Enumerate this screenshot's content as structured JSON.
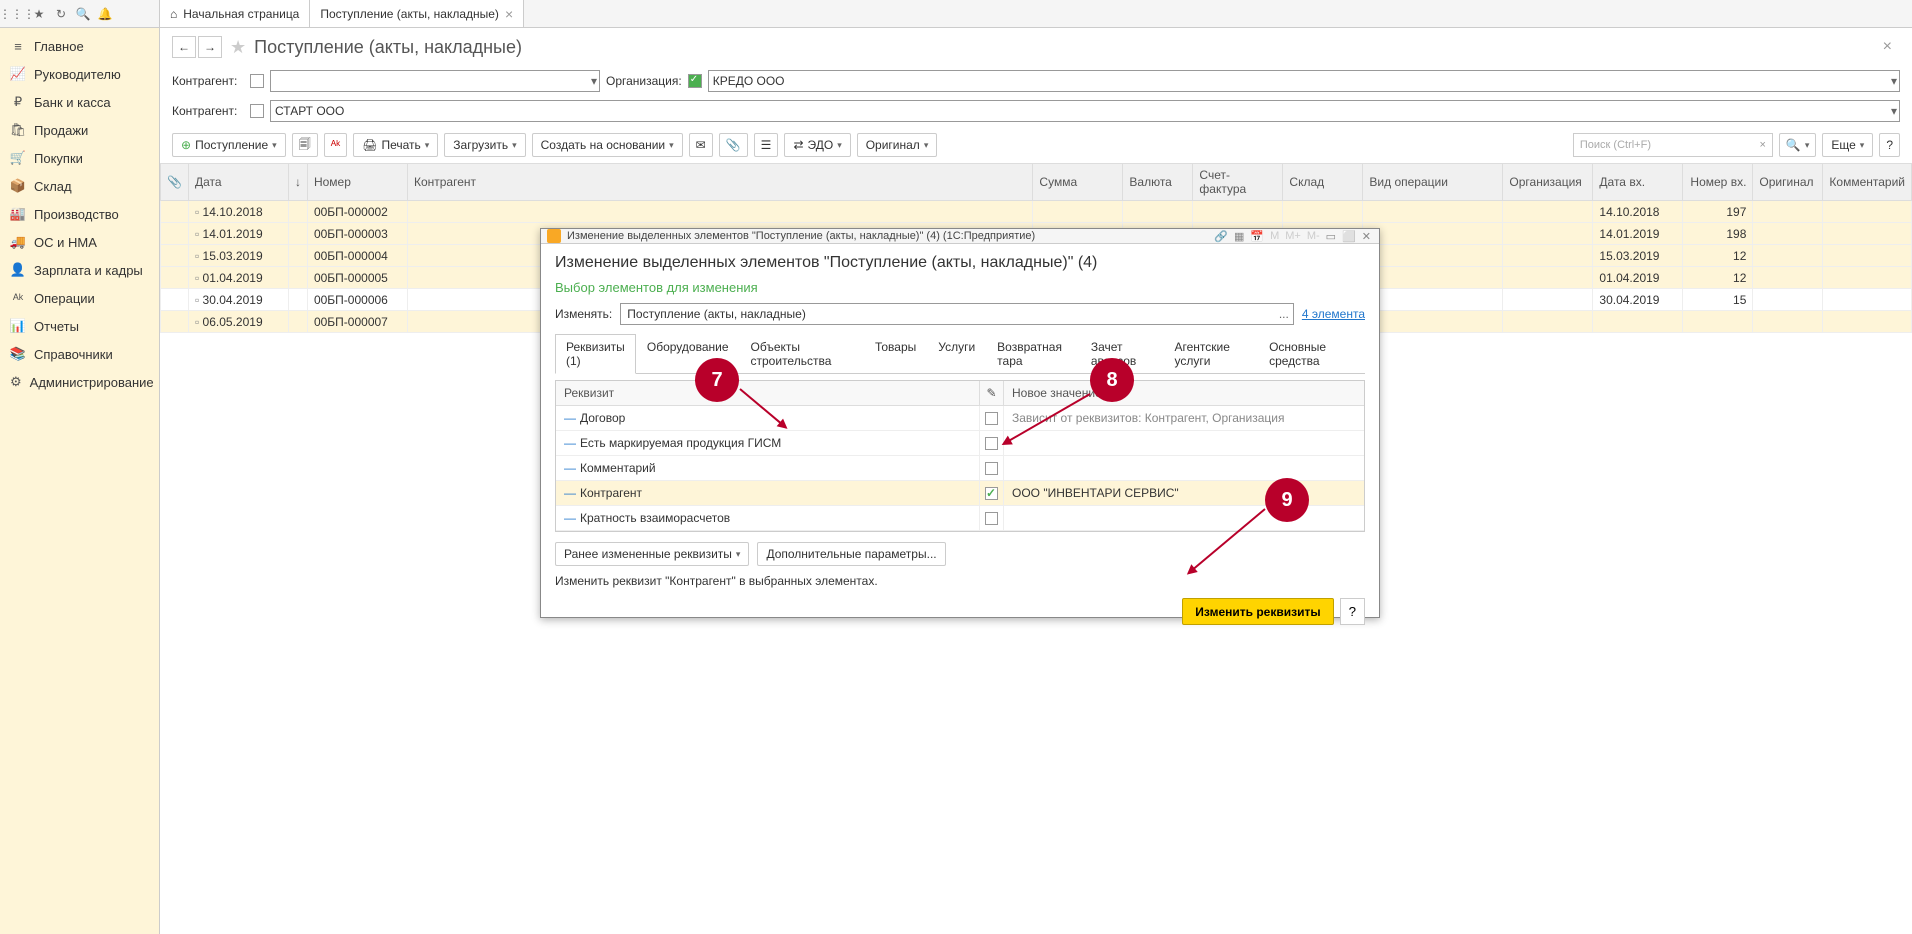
{
  "top_tabs": [
    {
      "icon": "home",
      "label": "Начальная страница"
    },
    {
      "icon": "",
      "label": "Поступление (акты, накладные)"
    }
  ],
  "sidebar": [
    {
      "icon": "≡",
      "label": "Главное"
    },
    {
      "icon": "📈",
      "label": "Руководителю"
    },
    {
      "icon": "₽",
      "label": "Банк и касса"
    },
    {
      "icon": "🛍",
      "label": "Продажи"
    },
    {
      "icon": "🛒",
      "label": "Покупки"
    },
    {
      "icon": "📦",
      "label": "Склад"
    },
    {
      "icon": "🏭",
      "label": "Производство"
    },
    {
      "icon": "🚚",
      "label": "ОС и НМА"
    },
    {
      "icon": "👤",
      "label": "Зарплата и кадры"
    },
    {
      "icon": "ᴬᵏ",
      "label": "Операции"
    },
    {
      "icon": "📊",
      "label": "Отчеты"
    },
    {
      "icon": "📚",
      "label": "Справочники"
    },
    {
      "icon": "⚙",
      "label": "Администрирование"
    }
  ],
  "page": {
    "title": "Поступление (акты, накладные)",
    "filter1_label": "Контрагент:",
    "filter2_label": "Организация:",
    "filter3_label": "Контрагент:",
    "org_value": "КРЕДО ООО",
    "contr_value": "СТАРТ ООО"
  },
  "toolbar": {
    "receipt": "Поступление",
    "print": "Печать",
    "load": "Загрузить",
    "create_based": "Создать на основании",
    "edo": "ЭДО",
    "original": "Оригинал",
    "search_ph": "Поиск (Ctrl+F)",
    "more": "Еще"
  },
  "grid": {
    "headers": [
      "",
      "Дата",
      "↓",
      "Номер",
      "Контрагент",
      "Сумма",
      "Валюта",
      "Счет-фактура",
      "Склад",
      "Вид операции",
      "Организация",
      "Дата вх.",
      "Номер вх.",
      "Оригинал",
      "Комментарий"
    ],
    "rows": [
      {
        "date": "14.10.2018",
        "num": "00БП-000002",
        "date_in": "14.10.2018",
        "num_in": "197",
        "sel": true
      },
      {
        "date": "14.01.2019",
        "num": "00БП-000003",
        "date_in": "14.01.2019",
        "num_in": "198",
        "sel": true
      },
      {
        "date": "15.03.2019",
        "num": "00БП-000004",
        "date_in": "15.03.2019",
        "num_in": "12",
        "sel": true
      },
      {
        "date": "01.04.2019",
        "num": "00БП-000005",
        "date_in": "01.04.2019",
        "num_in": "12",
        "sel": true
      },
      {
        "date": "30.04.2019",
        "num": "00БП-000006",
        "date_in": "30.04.2019",
        "num_in": "15",
        "sel": false
      },
      {
        "date": "06.05.2019",
        "num": "00БП-000007",
        "date_in": "",
        "num_in": "",
        "sel": true
      }
    ]
  },
  "modal": {
    "win_title": "Изменение выделенных элементов \"Поступление (акты, накладные)\" (4)  (1С:Предприятие)",
    "title": "Изменение выделенных элементов \"Поступление (акты, накладные)\" (4)",
    "subtitle": "Выбор элементов для изменения",
    "change_label": "Изменять:",
    "change_value": "Поступление (акты, накладные)",
    "elements_link": "4 элемента",
    "tabs": [
      "Реквизиты (1)",
      "Оборудование",
      "Объекты строительства",
      "Товары",
      "Услуги",
      "Возвратная тара",
      "Зачет авансов",
      "Агентские услуги",
      "Основные средства"
    ],
    "col_req": "Реквизит",
    "col_new": "Новое значение",
    "rows": [
      {
        "name": "Договор",
        "checked": false,
        "value": "Зависит от реквизитов: Контрагент, Организация"
      },
      {
        "name": "Есть маркируемая продукция ГИСМ",
        "checked": false,
        "value": ""
      },
      {
        "name": "Комментарий",
        "checked": false,
        "value": ""
      },
      {
        "name": "Контрагент",
        "checked": true,
        "value": "ООО \"ИНВЕНТАРИ СЕРВИС\"",
        "hl": true
      },
      {
        "name": "Кратность взаиморасчетов",
        "checked": false,
        "value": ""
      }
    ],
    "prev_btn": "Ранее измененные реквизиты",
    "extra_btn": "Дополнительные параметры...",
    "info": "Изменить реквизит \"Контрагент\" в выбранных элементах.",
    "apply": "Изменить реквизиты"
  },
  "badges": {
    "b7": "7",
    "b8": "8",
    "b9": "9"
  }
}
